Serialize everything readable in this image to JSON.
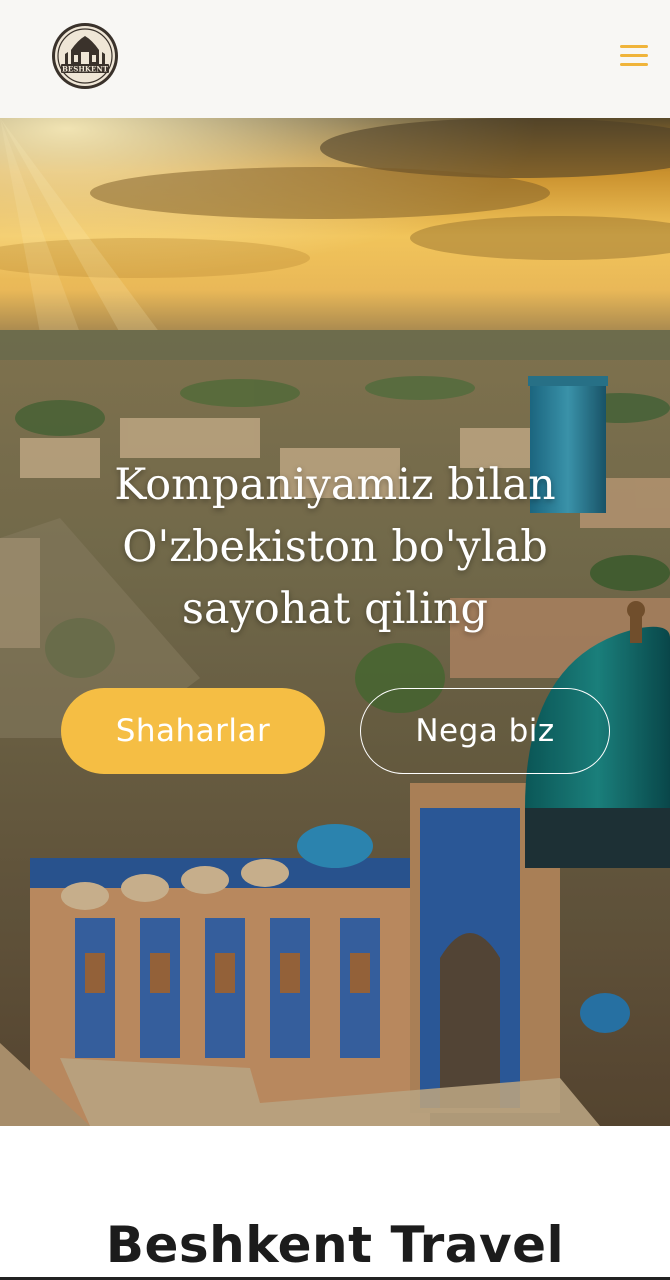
{
  "header": {
    "logo_text": "BESHKENT",
    "menu_icon": "hamburger-menu-icon",
    "accent_color": "#f0b43a"
  },
  "hero": {
    "title": "Kompaniyamiz bilan O'zbekiston bo'ylab sayohat qiling",
    "primary_button": "Shaharlar",
    "secondary_button": "Nega biz",
    "primary_color": "#f5be44"
  },
  "section": {
    "title": "Beshkent Travel"
  }
}
